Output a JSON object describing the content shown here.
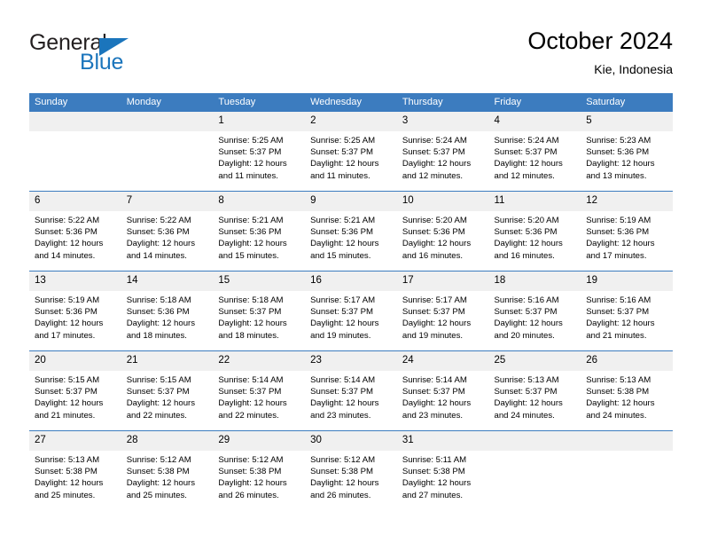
{
  "brand": {
    "name_top": "General",
    "name_bottom": "Blue",
    "color_dark": "#231f20",
    "color_blue": "#1b75bc"
  },
  "header": {
    "title": "October 2024",
    "subtitle": "Kie, Indonesia"
  },
  "theme": {
    "header_bar": "#3c7cbf",
    "daynum_band": "#f0f0f0",
    "cell_bg": "#ffffff",
    "text": "#000000"
  },
  "weekdays": [
    "Sunday",
    "Monday",
    "Tuesday",
    "Wednesday",
    "Thursday",
    "Friday",
    "Saturday"
  ],
  "weeks": [
    [
      {
        "day": "",
        "lines": []
      },
      {
        "day": "",
        "lines": []
      },
      {
        "day": "1",
        "lines": [
          "Sunrise: 5:25 AM",
          "Sunset: 5:37 PM",
          "Daylight: 12 hours",
          "and 11 minutes."
        ]
      },
      {
        "day": "2",
        "lines": [
          "Sunrise: 5:25 AM",
          "Sunset: 5:37 PM",
          "Daylight: 12 hours",
          "and 11 minutes."
        ]
      },
      {
        "day": "3",
        "lines": [
          "Sunrise: 5:24 AM",
          "Sunset: 5:37 PM",
          "Daylight: 12 hours",
          "and 12 minutes."
        ]
      },
      {
        "day": "4",
        "lines": [
          "Sunrise: 5:24 AM",
          "Sunset: 5:37 PM",
          "Daylight: 12 hours",
          "and 12 minutes."
        ]
      },
      {
        "day": "5",
        "lines": [
          "Sunrise: 5:23 AM",
          "Sunset: 5:36 PM",
          "Daylight: 12 hours",
          "and 13 minutes."
        ]
      }
    ],
    [
      {
        "day": "6",
        "lines": [
          "Sunrise: 5:22 AM",
          "Sunset: 5:36 PM",
          "Daylight: 12 hours",
          "and 14 minutes."
        ]
      },
      {
        "day": "7",
        "lines": [
          "Sunrise: 5:22 AM",
          "Sunset: 5:36 PM",
          "Daylight: 12 hours",
          "and 14 minutes."
        ]
      },
      {
        "day": "8",
        "lines": [
          "Sunrise: 5:21 AM",
          "Sunset: 5:36 PM",
          "Daylight: 12 hours",
          "and 15 minutes."
        ]
      },
      {
        "day": "9",
        "lines": [
          "Sunrise: 5:21 AM",
          "Sunset: 5:36 PM",
          "Daylight: 12 hours",
          "and 15 minutes."
        ]
      },
      {
        "day": "10",
        "lines": [
          "Sunrise: 5:20 AM",
          "Sunset: 5:36 PM",
          "Daylight: 12 hours",
          "and 16 minutes."
        ]
      },
      {
        "day": "11",
        "lines": [
          "Sunrise: 5:20 AM",
          "Sunset: 5:36 PM",
          "Daylight: 12 hours",
          "and 16 minutes."
        ]
      },
      {
        "day": "12",
        "lines": [
          "Sunrise: 5:19 AM",
          "Sunset: 5:36 PM",
          "Daylight: 12 hours",
          "and 17 minutes."
        ]
      }
    ],
    [
      {
        "day": "13",
        "lines": [
          "Sunrise: 5:19 AM",
          "Sunset: 5:36 PM",
          "Daylight: 12 hours",
          "and 17 minutes."
        ]
      },
      {
        "day": "14",
        "lines": [
          "Sunrise: 5:18 AM",
          "Sunset: 5:36 PM",
          "Daylight: 12 hours",
          "and 18 minutes."
        ]
      },
      {
        "day": "15",
        "lines": [
          "Sunrise: 5:18 AM",
          "Sunset: 5:37 PM",
          "Daylight: 12 hours",
          "and 18 minutes."
        ]
      },
      {
        "day": "16",
        "lines": [
          "Sunrise: 5:17 AM",
          "Sunset: 5:37 PM",
          "Daylight: 12 hours",
          "and 19 minutes."
        ]
      },
      {
        "day": "17",
        "lines": [
          "Sunrise: 5:17 AM",
          "Sunset: 5:37 PM",
          "Daylight: 12 hours",
          "and 19 minutes."
        ]
      },
      {
        "day": "18",
        "lines": [
          "Sunrise: 5:16 AM",
          "Sunset: 5:37 PM",
          "Daylight: 12 hours",
          "and 20 minutes."
        ]
      },
      {
        "day": "19",
        "lines": [
          "Sunrise: 5:16 AM",
          "Sunset: 5:37 PM",
          "Daylight: 12 hours",
          "and 21 minutes."
        ]
      }
    ],
    [
      {
        "day": "20",
        "lines": [
          "Sunrise: 5:15 AM",
          "Sunset: 5:37 PM",
          "Daylight: 12 hours",
          "and 21 minutes."
        ]
      },
      {
        "day": "21",
        "lines": [
          "Sunrise: 5:15 AM",
          "Sunset: 5:37 PM",
          "Daylight: 12 hours",
          "and 22 minutes."
        ]
      },
      {
        "day": "22",
        "lines": [
          "Sunrise: 5:14 AM",
          "Sunset: 5:37 PM",
          "Daylight: 12 hours",
          "and 22 minutes."
        ]
      },
      {
        "day": "23",
        "lines": [
          "Sunrise: 5:14 AM",
          "Sunset: 5:37 PM",
          "Daylight: 12 hours",
          "and 23 minutes."
        ]
      },
      {
        "day": "24",
        "lines": [
          "Sunrise: 5:14 AM",
          "Sunset: 5:37 PM",
          "Daylight: 12 hours",
          "and 23 minutes."
        ]
      },
      {
        "day": "25",
        "lines": [
          "Sunrise: 5:13 AM",
          "Sunset: 5:37 PM",
          "Daylight: 12 hours",
          "and 24 minutes."
        ]
      },
      {
        "day": "26",
        "lines": [
          "Sunrise: 5:13 AM",
          "Sunset: 5:38 PM",
          "Daylight: 12 hours",
          "and 24 minutes."
        ]
      }
    ],
    [
      {
        "day": "27",
        "lines": [
          "Sunrise: 5:13 AM",
          "Sunset: 5:38 PM",
          "Daylight: 12 hours",
          "and 25 minutes."
        ]
      },
      {
        "day": "28",
        "lines": [
          "Sunrise: 5:12 AM",
          "Sunset: 5:38 PM",
          "Daylight: 12 hours",
          "and 25 minutes."
        ]
      },
      {
        "day": "29",
        "lines": [
          "Sunrise: 5:12 AM",
          "Sunset: 5:38 PM",
          "Daylight: 12 hours",
          "and 26 minutes."
        ]
      },
      {
        "day": "30",
        "lines": [
          "Sunrise: 5:12 AM",
          "Sunset: 5:38 PM",
          "Daylight: 12 hours",
          "and 26 minutes."
        ]
      },
      {
        "day": "31",
        "lines": [
          "Sunrise: 5:11 AM",
          "Sunset: 5:38 PM",
          "Daylight: 12 hours",
          "and 27 minutes."
        ]
      },
      {
        "day": "",
        "lines": []
      },
      {
        "day": "",
        "lines": []
      }
    ]
  ]
}
